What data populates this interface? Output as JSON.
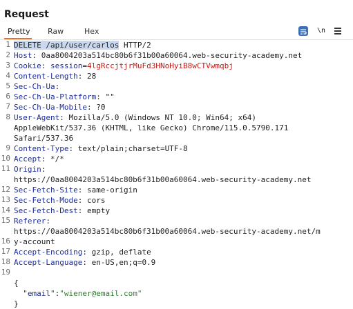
{
  "panel": {
    "title": "Request"
  },
  "tabs": [
    {
      "label": "Pretty"
    },
    {
      "label": "Raw"
    },
    {
      "label": "Hex"
    }
  ],
  "toolbar": {
    "wrap_icon": "text-wrap-icon",
    "newline_label": "\\n",
    "menu_icon": "hamburger-menu-icon"
  },
  "request": {
    "method": "DELETE",
    "path": "/api/user/carlos",
    "protocol": "HTTP/2",
    "headers": [
      {
        "name": "Host",
        "value": "0aa8004203a514bc80b6f31b00a60064.web-security-academy.net"
      },
      {
        "name": "Cookie",
        "cookie_name": "session",
        "cookie_value": "4lgRccjtjrMuFd3HNoHyiB8wCTVwmqbj"
      },
      {
        "name": "Content-Length",
        "value": "28"
      },
      {
        "name": "Sec-Ch-Ua",
        "value": ""
      },
      {
        "name": "Sec-Ch-Ua-Platform",
        "value": "\"\""
      },
      {
        "name": "Sec-Ch-Ua-Mobile",
        "value": "?0"
      },
      {
        "name": "User-Agent",
        "value_lines": [
          "Mozilla/5.0 (Windows NT 10.0; Win64; x64)",
          "AppleWebKit/537.36 (KHTML, like Gecko) Chrome/115.0.5790.171",
          "Safari/537.36"
        ]
      },
      {
        "name": "Content-Type",
        "value": "text/plain;charset=UTF-8"
      },
      {
        "name": "Accept",
        "value": "*/*"
      },
      {
        "name": "Origin",
        "value_lines": [
          "",
          "https://0aa8004203a514bc80b6f31b00a60064.web-security-academy.net"
        ]
      },
      {
        "name": "Sec-Fetch-Site",
        "value": "same-origin"
      },
      {
        "name": "Sec-Fetch-Mode",
        "value": "cors"
      },
      {
        "name": "Sec-Fetch-Dest",
        "value": "empty"
      },
      {
        "name": "Referer",
        "value_lines": [
          "",
          "https://0aa8004203a514bc80b6f31b00a60064.web-security-academy.net/m",
          "y-account"
        ]
      },
      {
        "name": "Accept-Encoding",
        "value": "gzip, deflate"
      },
      {
        "name": "Accept-Language",
        "value": "en-US,en;q=0.9"
      }
    ],
    "body": {
      "open": "{",
      "key": "\"email\"",
      "colon": ":",
      "value": "\"wiener@email.com\"",
      "close": "}"
    }
  },
  "line_numbers": [
    "1",
    "2",
    "3",
    "4",
    "5",
    "6",
    "7",
    "8",
    "9",
    "10",
    "11",
    "12",
    "13",
    "14",
    "15",
    "16",
    "17",
    "18",
    "19"
  ]
}
